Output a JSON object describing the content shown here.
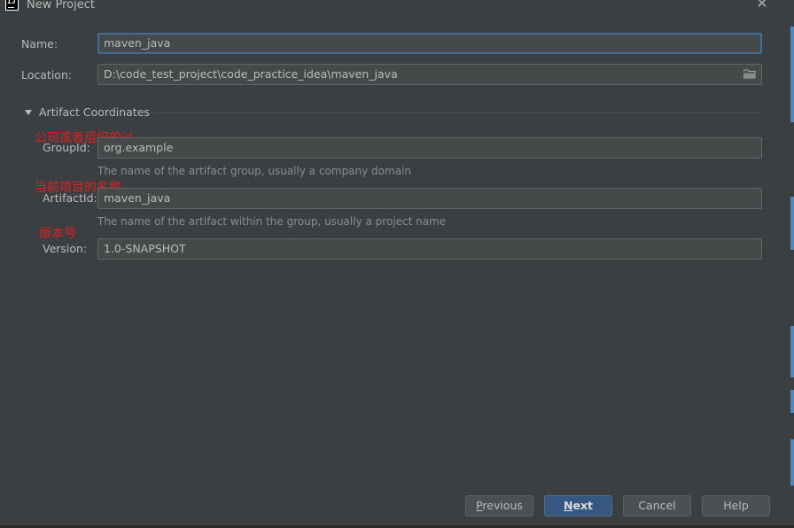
{
  "window": {
    "title": "New Project",
    "close_glyph": "✕"
  },
  "form": {
    "name_label": "Name:",
    "name_value": "maven_java",
    "location_label": "Location:",
    "location_value": "D:\\code_test_project\\code_practice_idea\\maven_java",
    "section_label": "Artifact Coordinates",
    "groupid_label": "GroupId:",
    "groupid_value": "org.example",
    "groupid_hint": "The name of the artifact group, usually a company domain",
    "artifactid_label": "ArtifactId:",
    "artifactid_value": "maven_java",
    "artifactid_hint": "The name of the artifact within the group, usually a project name",
    "version_label": "Version:",
    "version_value": "1.0-SNAPSHOT"
  },
  "annotations": {
    "groupid_note": "公司或者组织的id",
    "artifactid_note": "当前项目的名称",
    "version_note": "版本号"
  },
  "buttons": {
    "previous_first": "P",
    "previous_rest": "revious",
    "next_first": "N",
    "next_rest": "ext",
    "cancel": "Cancel",
    "help": "Help"
  },
  "colors": {
    "background": "#3c3f41",
    "field_bg": "#45494a",
    "focus_border": "#466d94",
    "primary_button": "#365880",
    "annotation_red": "#e02020"
  },
  "icons": [
    "app-icon",
    "close-icon",
    "folder-icon",
    "collapse-triangle-icon"
  ]
}
